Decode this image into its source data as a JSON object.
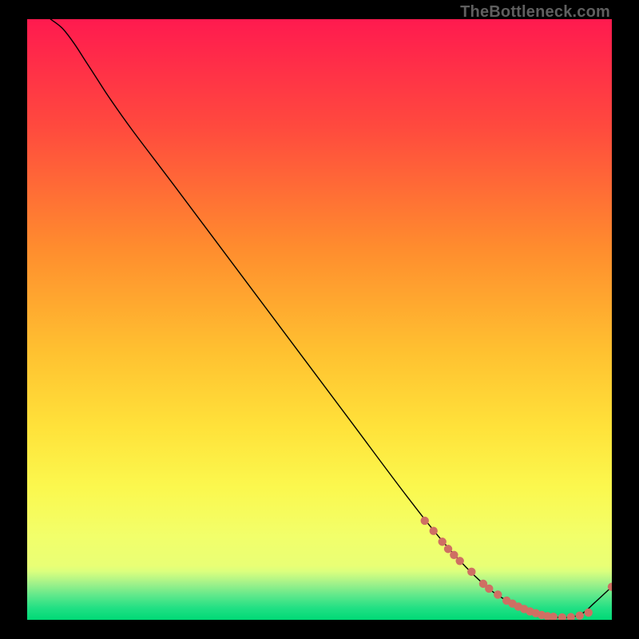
{
  "watermark": "TheBottleneck.com",
  "chart_data": {
    "type": "line",
    "title": "",
    "subtitle": "",
    "xlabel": "",
    "ylabel": "",
    "xlim": [
      0,
      100
    ],
    "ylim": [
      0,
      100
    ],
    "grid": false,
    "axes_visible": false,
    "background_gradient": {
      "top": "#ff1a4f",
      "mid": "#ffd83a",
      "near_bottom": "#e9ff75",
      "bottom": "#00e07a",
      "green_band_start_pct": 92
    },
    "series": [
      {
        "name": "bottleneck-curve",
        "color": "#000000",
        "stroke_width": 1.4,
        "x": [
          4.0,
          6.0,
          8.0,
          10.0,
          12.0,
          14.0,
          18.0,
          25.0,
          35.0,
          45.0,
          55.0,
          65.0,
          72.0,
          78.0,
          82.0,
          85.0,
          87.0,
          89.0,
          91.0,
          93.0,
          95.0,
          97.0,
          100.0
        ],
        "y": [
          100.0,
          98.5,
          96.0,
          93.0,
          90.0,
          87.0,
          81.5,
          72.5,
          59.5,
          46.5,
          33.5,
          20.5,
          12.0,
          6.0,
          3.2,
          1.8,
          1.1,
          0.6,
          0.4,
          0.45,
          1.1,
          2.8,
          5.5
        ]
      },
      {
        "name": "data-points-segment",
        "color": "#cf6f63",
        "marker_radius": 5.2,
        "x": [
          68.0,
          69.5,
          71.0,
          72.0,
          73.0,
          74.0,
          76.0,
          78.0,
          79.0,
          80.5,
          82.0,
          83.0,
          84.0,
          85.0,
          86.0,
          87.0,
          88.0,
          89.0,
          90.0,
          91.5,
          93.0,
          94.5,
          96.0,
          100.0
        ],
        "y": [
          16.5,
          14.8,
          13.0,
          11.8,
          10.8,
          9.8,
          8.0,
          6.0,
          5.2,
          4.2,
          3.2,
          2.7,
          2.2,
          1.8,
          1.4,
          1.1,
          0.8,
          0.6,
          0.5,
          0.4,
          0.45,
          0.7,
          1.2,
          5.5
        ]
      }
    ]
  }
}
